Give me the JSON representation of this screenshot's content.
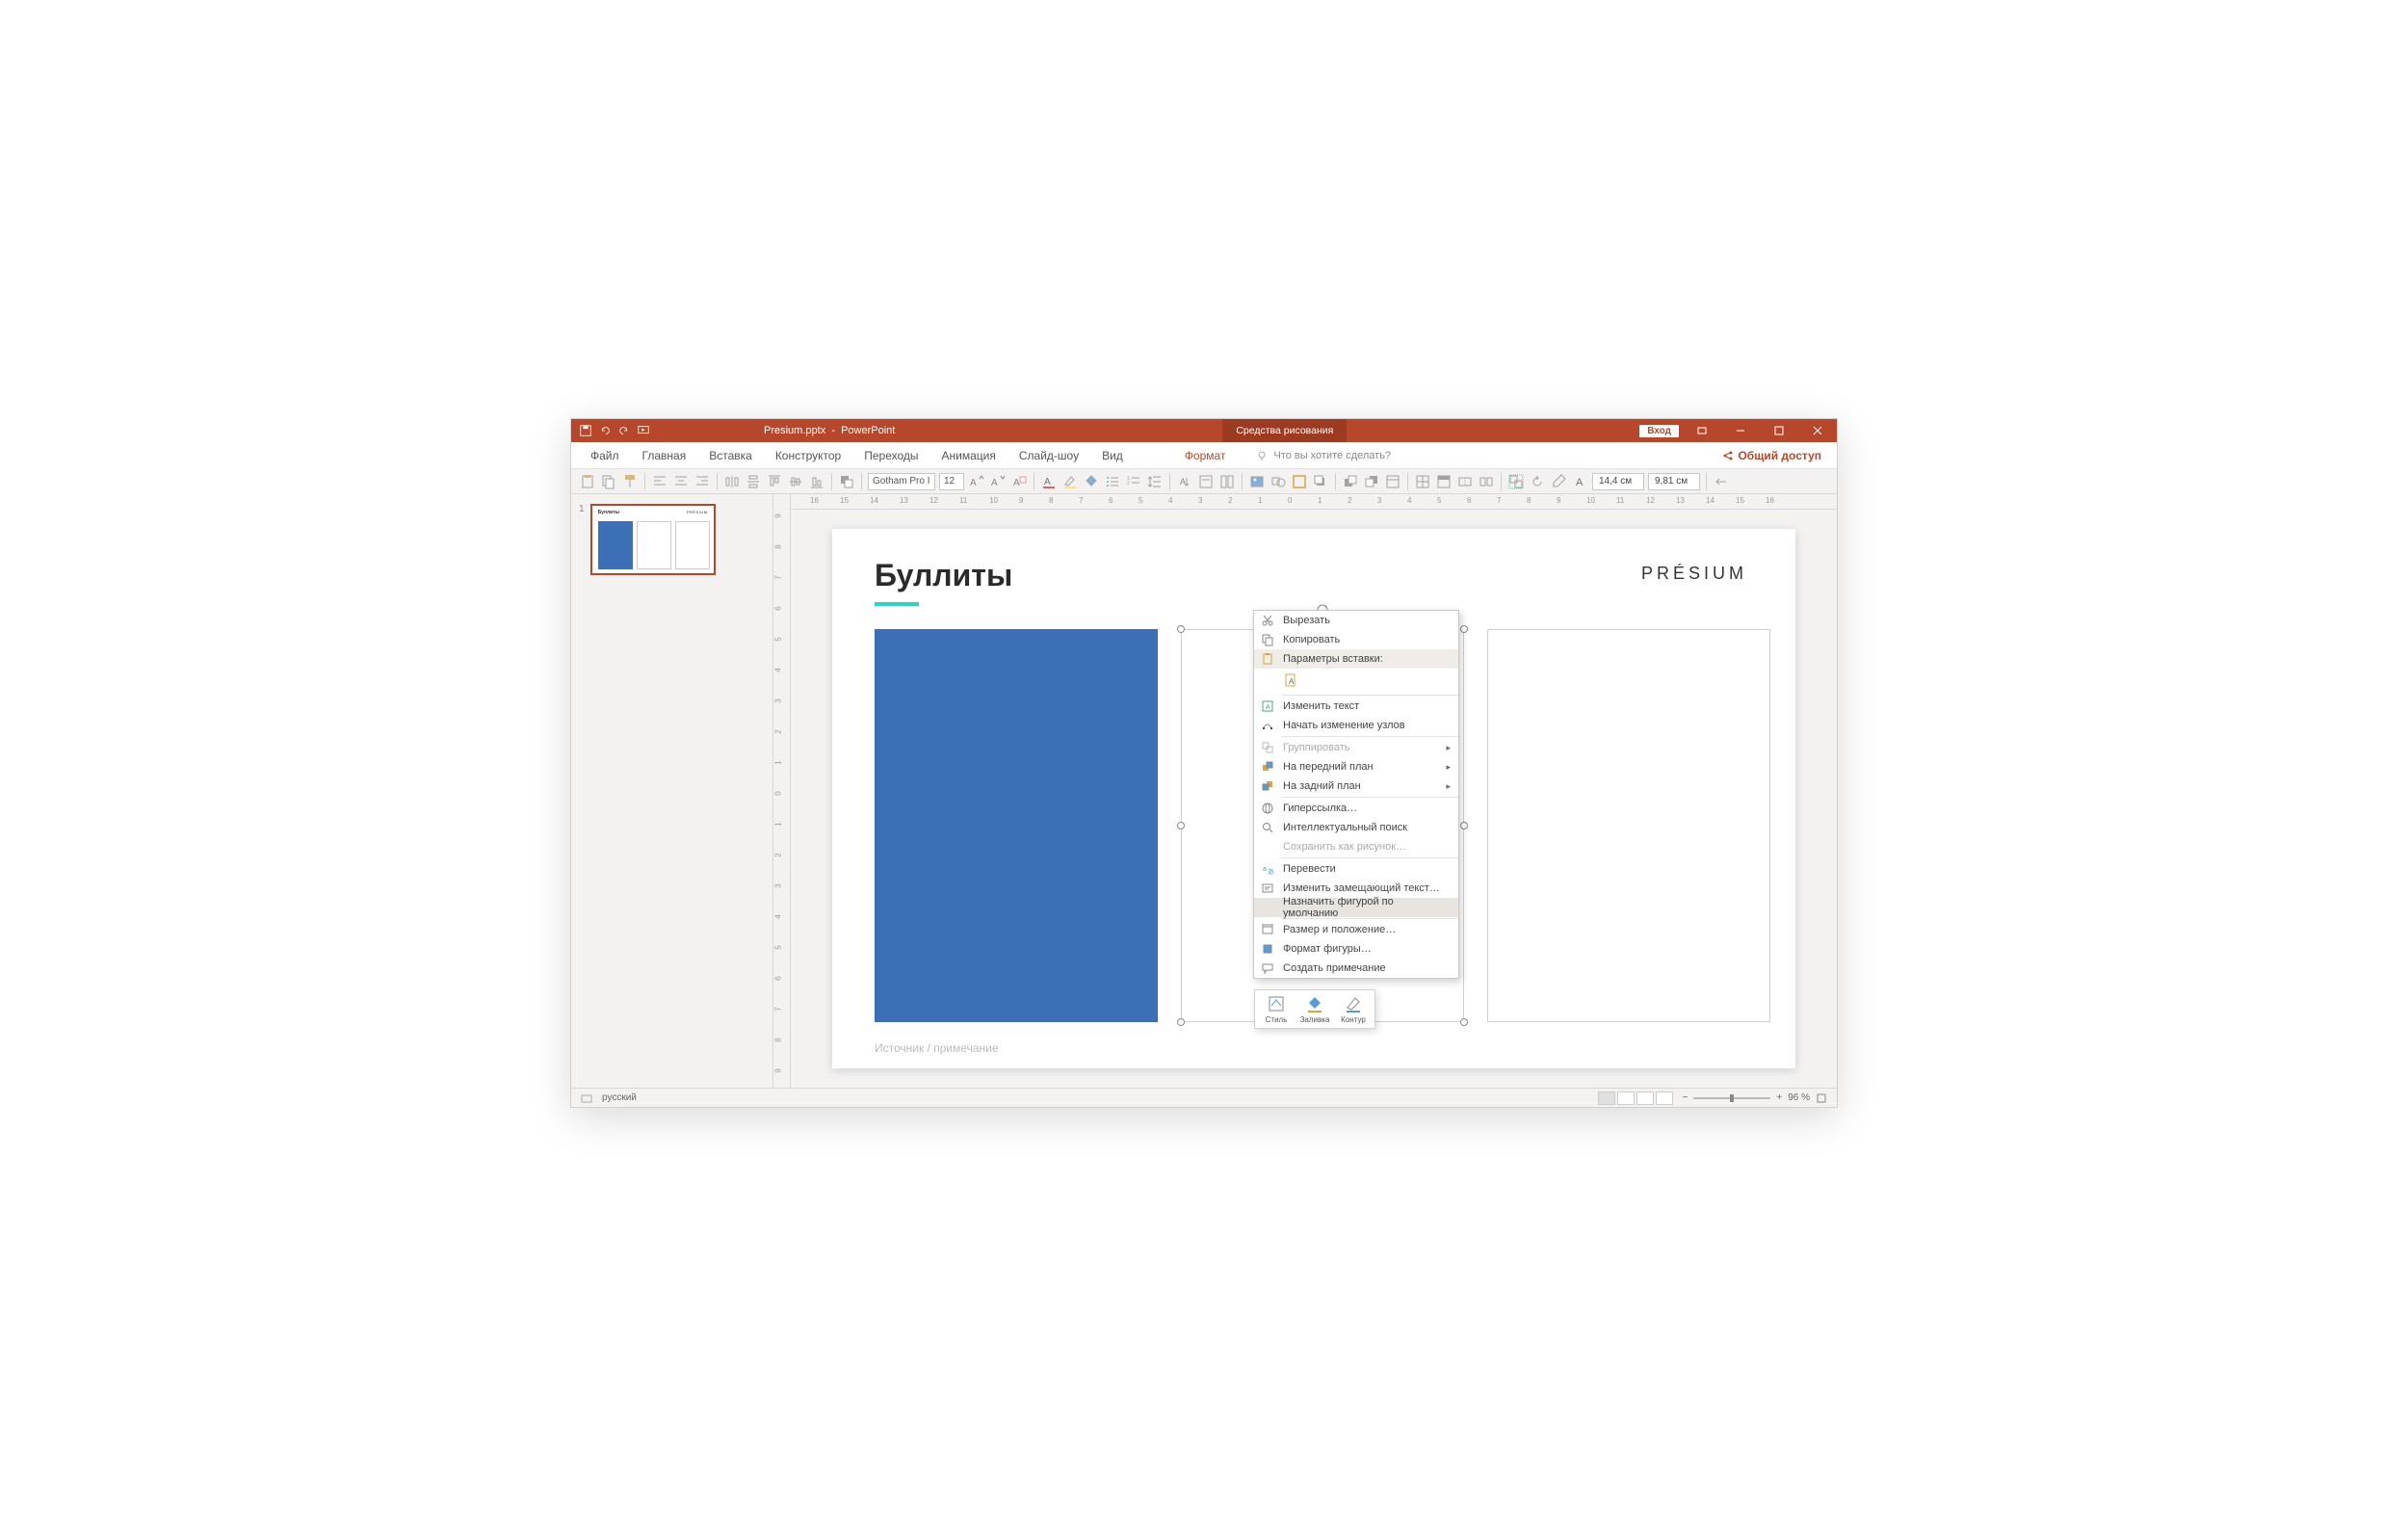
{
  "title": {
    "filename": "Presium.pptx",
    "app": "PowerPoint",
    "context_tab": "Средства рисования",
    "signin": "Вход"
  },
  "tabs": {
    "file": "Файл",
    "home": "Главная",
    "insert": "Вставка",
    "design": "Конструктор",
    "transitions": "Переходы",
    "animations": "Анимация",
    "slideshow": "Слайд-шоу",
    "view": "Вид",
    "format": "Формат"
  },
  "tellme": "Что вы хотите сделать?",
  "share": "Общий доступ",
  "toolbar": {
    "font_name": "Gotham Pro I",
    "font_size": "12",
    "height": "14,4 см",
    "width": "9,81 см"
  },
  "thumb": {
    "num": "1"
  },
  "ruler_h": [
    "16",
    "15",
    "14",
    "13",
    "12",
    "11",
    "10",
    "9",
    "8",
    "7",
    "6",
    "5",
    "4",
    "3",
    "2",
    "1",
    "0",
    "1",
    "2",
    "3",
    "4",
    "5",
    "6",
    "7",
    "8",
    "9",
    "10",
    "11",
    "12",
    "13",
    "14",
    "15",
    "16"
  ],
  "ruler_v": [
    "9",
    "8",
    "7",
    "6",
    "5",
    "4",
    "3",
    "2",
    "1",
    "0",
    "1",
    "2",
    "3",
    "4",
    "5",
    "6",
    "7",
    "8",
    "9"
  ],
  "slide": {
    "title": "Буллиты",
    "logo": "PRÉSIUM",
    "footer": "Источник / примечание"
  },
  "context_menu": {
    "cut": "Вырезать",
    "copy": "Копировать",
    "paste_header": "Параметры вставки:",
    "edit_text": "Изменить текст",
    "edit_points": "Начать изменение узлов",
    "group": "Группировать",
    "bring_front": "На передний план",
    "send_back": "На задний план",
    "hyperlink": "Гиперссылка…",
    "smart_lookup": "Интеллектуальный поиск",
    "save_picture": "Сохранить как рисунок…",
    "translate": "Перевести",
    "alt_text": "Изменить замещающий текст…",
    "set_default": "Назначить фигурой по умолчанию",
    "size_position": "Размер и положение…",
    "format_shape": "Формат фигуры…",
    "new_comment": "Создать примечание"
  },
  "mini_toolbar": {
    "style": "Стиль",
    "fill": "Заливка",
    "outline": "Контур"
  },
  "status": {
    "lang": "русский",
    "zoom": "96 %"
  }
}
